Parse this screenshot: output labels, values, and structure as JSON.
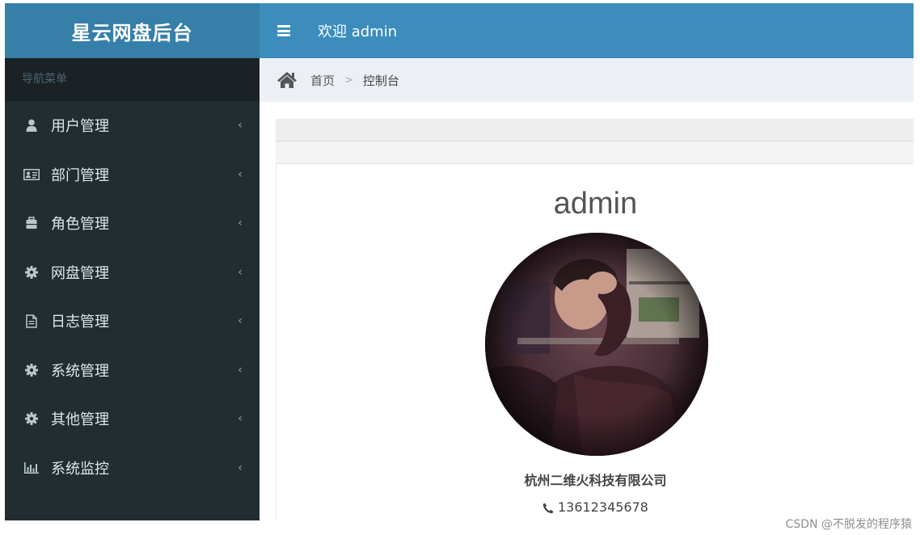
{
  "sidebar": {
    "logo": "星云网盘后台",
    "nav_header": "导航菜单",
    "items": [
      {
        "label": "用户管理",
        "icon": "user-icon"
      },
      {
        "label": "部门管理",
        "icon": "id-card-icon"
      },
      {
        "label": "角色管理",
        "icon": "briefcase-icon"
      },
      {
        "label": "网盘管理",
        "icon": "gear-icon"
      },
      {
        "label": "日志管理",
        "icon": "file-icon"
      },
      {
        "label": "系统管理",
        "icon": "gear-icon"
      },
      {
        "label": "其他管理",
        "icon": "gear-icon"
      },
      {
        "label": "系统监控",
        "icon": "bar-chart-icon"
      }
    ],
    "chevron": "‹"
  },
  "header": {
    "welcome": "欢迎 admin"
  },
  "breadcrumb": {
    "home": "首页",
    "separator": ">",
    "current": "控制台"
  },
  "profile": {
    "name": "admin",
    "company": "杭州二维火科技有限公司",
    "phone": "13612345678"
  },
  "watermark": "CSDN @不脱发的程序猿",
  "colors": {
    "sidebar_bg": "#222d32",
    "logo_bg": "#367fa9",
    "header_bg": "#3c8dbc",
    "breadcrumb_bg": "#ecf0f5"
  }
}
